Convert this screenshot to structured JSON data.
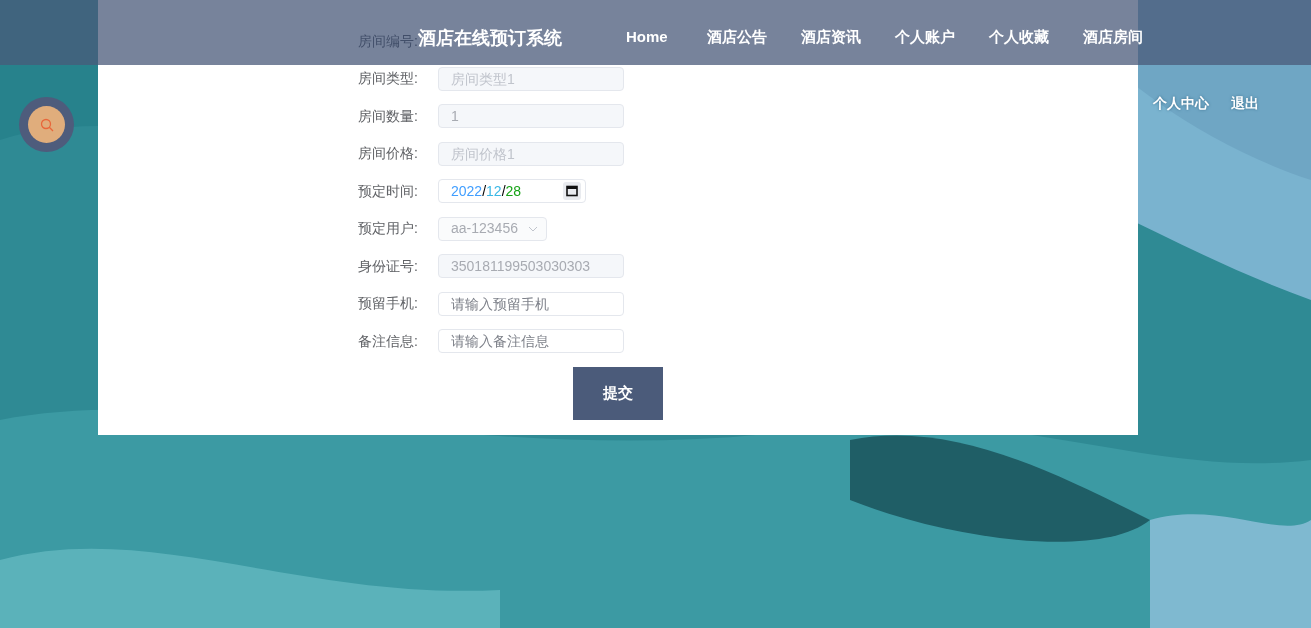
{
  "header": {
    "title": "酒店在线预订系统",
    "nav": [
      {
        "label": "Home",
        "selected": false
      },
      {
        "label": "酒店公告",
        "selected": false
      },
      {
        "label": "酒店资讯",
        "selected": false
      },
      {
        "label": "个人账户",
        "selected": false
      },
      {
        "label": "个人收藏",
        "selected": false
      },
      {
        "label": "酒店房间",
        "selected": false
      }
    ]
  },
  "user_links": [
    "个人中心",
    "退出"
  ],
  "form": {
    "rows": [
      {
        "label": "房间编号:",
        "kind": "hidden"
      },
      {
        "label": "房间类型:",
        "kind": "text",
        "placeholder": "房间类型1",
        "disabled": true
      },
      {
        "label": "房间数量:",
        "kind": "text",
        "value": "1",
        "disabled": true
      },
      {
        "label": "房间价格:",
        "kind": "text",
        "placeholder": "房间价格1",
        "disabled": true
      },
      {
        "label": "预定时间:",
        "kind": "date",
        "segments": [
          {
            "text": "2022",
            "color": "#409eff"
          },
          {
            "text": "/",
            "color": "#000000"
          },
          {
            "text": "12",
            "color": "#3bb8e6"
          },
          {
            "text": "/",
            "color": "#000000"
          },
          {
            "text": "28",
            "color": "#17a317"
          }
        ]
      },
      {
        "label": "预定用户:",
        "kind": "select",
        "value": "aa-123456",
        "disabled": true
      },
      {
        "label": "身份证号:",
        "kind": "text",
        "value": "350181199503030303",
        "disabled": true
      },
      {
        "label": "预留手机:",
        "kind": "text",
        "placeholder": "请输入预留手机",
        "disabled": false
      },
      {
        "label": "备注信息:",
        "kind": "text",
        "placeholder": "请输入备注信息",
        "disabled": false
      }
    ],
    "submit": "提交"
  }
}
